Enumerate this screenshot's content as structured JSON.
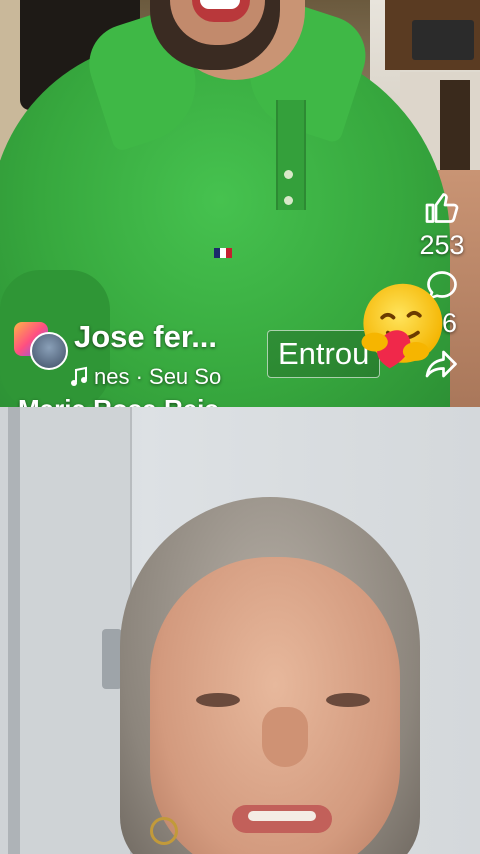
{
  "live": {
    "host_name": "Jose fer...",
    "music_text": "nes · Seu So",
    "guest_name_partial": "Maria Rosa Reis",
    "join_text": "Entrou",
    "likes_count": "253",
    "comments_count": "86"
  },
  "icons": {
    "like": "thumbs-up-icon",
    "comment": "comment-bubble-icon",
    "share": "share-arrow-icon",
    "music": "music-note-icon",
    "reaction": "care-emoji-icon"
  }
}
